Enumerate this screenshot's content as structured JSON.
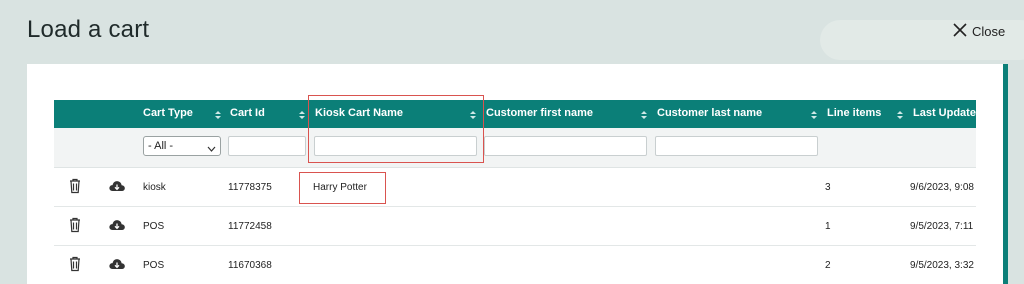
{
  "dialog": {
    "title": "Load a cart",
    "close_label": "Close"
  },
  "table": {
    "columns": [
      {
        "key": "cart_type",
        "label": "Cart Type"
      },
      {
        "key": "cart_id",
        "label": "Cart Id"
      },
      {
        "key": "kiosk_cart_name",
        "label": "Kiosk Cart Name"
      },
      {
        "key": "first_name",
        "label": "Customer first name"
      },
      {
        "key": "last_name",
        "label": "Customer last name"
      },
      {
        "key": "line_items",
        "label": "Line items"
      },
      {
        "key": "last_updated",
        "label": "Last Updated"
      }
    ],
    "filter": {
      "cart_type_selected": "- All -"
    },
    "rows": [
      {
        "cart_type": "kiosk",
        "cart_id": "11778375",
        "kiosk_cart_name": "Harry Potter",
        "first_name": "",
        "last_name": "",
        "line_items": "3",
        "last_updated": "9/6/2023, 9:08"
      },
      {
        "cart_type": "POS",
        "cart_id": "11772458",
        "kiosk_cart_name": "",
        "first_name": "",
        "last_name": "",
        "line_items": "1",
        "last_updated": "9/5/2023, 7:11"
      },
      {
        "cart_type": "POS",
        "cart_id": "11670368",
        "kiosk_cart_name": "",
        "first_name": "",
        "last_name": "",
        "line_items": "2",
        "last_updated": "9/5/2023, 3:32"
      }
    ]
  },
  "icons": {
    "close": "close-icon",
    "delete": "trash-icon",
    "load": "cloud-download-icon",
    "sort": "sort-icon"
  },
  "colors": {
    "header": "#0b7f78",
    "highlight": "#d9534f"
  }
}
